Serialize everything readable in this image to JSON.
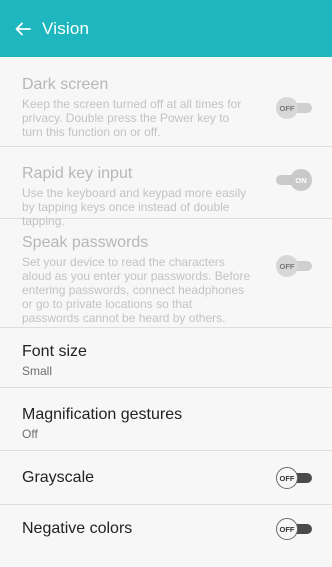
{
  "header": {
    "back_icon": "arrow-left-icon",
    "title": "Vision",
    "bg_color": "#1fb7bf"
  },
  "items": [
    {
      "title": "Dark screen",
      "desc": "Keep the screen turned off at all times for privacy. Double press the Power key to turn this function on or off.",
      "toggle": "OFF",
      "enabled": false
    },
    {
      "title": "Rapid key input",
      "desc": "Use the keyboard and keypad more easily by tapping keys once instead of double tapping.",
      "toggle": "ON",
      "enabled": false
    },
    {
      "title": "Speak passwords",
      "desc": "Set your device to read the characters aloud as you enter your passwords. Before entering passwords, connect headphones or go to private locations so that passwords cannot be heard by others.",
      "toggle": "OFF",
      "enabled": false
    },
    {
      "title": "Font size",
      "desc": "Small",
      "enabled": true
    },
    {
      "title": "Magnification gestures",
      "desc": "Off",
      "enabled": true
    },
    {
      "title": "Grayscale",
      "toggle": "OFF",
      "enabled": true
    },
    {
      "title": "Negative colors",
      "toggle": "OFF",
      "enabled": true
    }
  ]
}
